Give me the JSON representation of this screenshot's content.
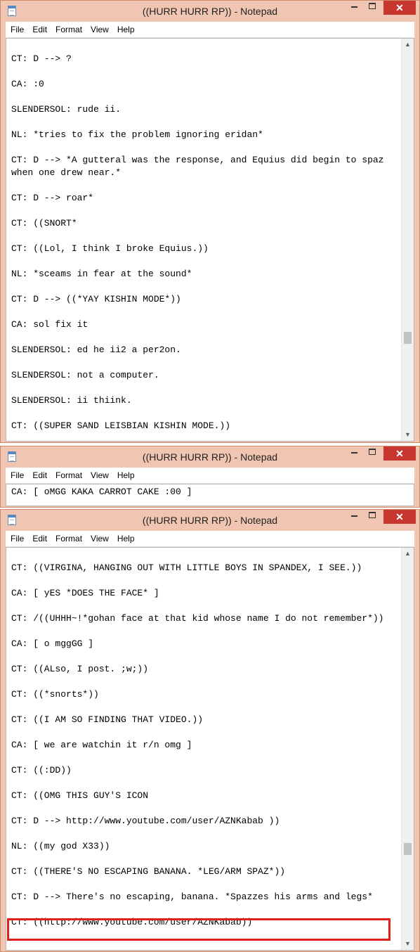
{
  "menu": [
    "File",
    "Edit",
    "Format",
    "View",
    "Help"
  ],
  "window_controls": {
    "minimize": "",
    "maximize": "",
    "close": "✕"
  },
  "scroll": {
    "up_arrow": "▲",
    "down_arrow": "▼"
  },
  "colors": {
    "titlebar": "#f0c6b2",
    "close_button": "#c7372f",
    "highlight_box": "#e0201c"
  },
  "windows": [
    {
      "title": "((HURR HURR RP)) - Notepad",
      "lines": [
        "CT: D --> ?",
        "CA: :0",
        "SLENDERSOL: rude ii.",
        "NL: *tries to fix the problem ignoring eridan*",
        "CT: D --> *A gutteral was the response, and Equius did begin to spaz when one drew near.*",
        "CT: D --> roar*",
        "CT: ((SNORT*",
        "CT: ((Lol, I think I broke Equius.))",
        "NL: *sceams in fear at the sound*",
        "CT: D --> ((*YAY KISHIN MODE*))",
        "CA: sol fix it",
        "SLENDERSOL: ed he ii2 a per2on.",
        "SLENDERSOL: not a computer.",
        "SLENDERSOL: ii thiink.",
        "CT: ((SUPER SAND LEISBIAN KISHIN MODE.))"
      ]
    },
    {
      "title": "((HURR HURR RP)) - Notepad",
      "lines": [
        "CA: [ oMGG KAKA CARROT CAKE :00 ]"
      ]
    },
    {
      "title": "((HURR HURR RP)) - Notepad",
      "lines": [
        "CT: ((VIRGINA, HANGING OUT WITH LITTLE BOYS IN SPANDEX, I SEE.))",
        "CA: [ yES *DOES THE FACE* ]",
        "CT: /((UHHH~!*gohan face at that kid whose name I do not remember*))",
        "CA: [ o mggGG ]",
        "CT: ((ALso, I post. ;w;))",
        "CT: ((*snorts*))",
        "CT: ((I AM SO FINDING THAT VIDEO.))",
        "CA: [ we are watchin it r/n omg ]",
        "CT: ((:DD))",
        "CT: ((OMG THIS GUY'S ICON",
        "CT: D --> http://www.youtube.com/user/AZNKabab ))",
        "NL: ((my god X33))",
        "CT: ((THERE'S NO ESCAPING BANANA. *LEG/ARM SPAZ*))",
        "CT: D --> There's no escaping, banana. *Spazzes his arms and legs*",
        "CT: ((http://www.youtube.com/user/AZNKabab))"
      ]
    }
  ]
}
